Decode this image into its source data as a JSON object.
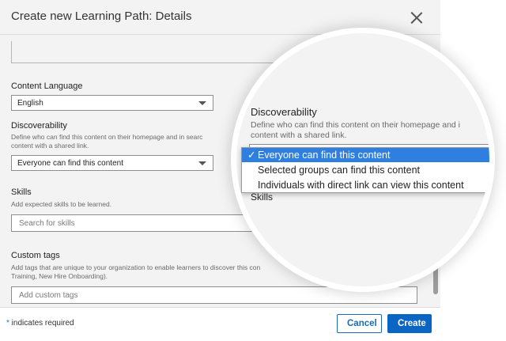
{
  "dialog": {
    "title": "Create new Learning Path: Details"
  },
  "form": {
    "content_language": {
      "label": "Content Language",
      "value": "English"
    },
    "discoverability": {
      "label": "Discoverability",
      "hint_line1": "Define who can find this content on their homepage and in searc",
      "hint_line2": "content with a shared link.",
      "value": "Everyone can find this content"
    },
    "skills": {
      "label": "Skills",
      "hint": "Add expected skills to be learned.",
      "placeholder": "Search for skills"
    },
    "custom_tags": {
      "label": "Custom tags",
      "hint_line1": "Add tags that are unique to your organization to enable learners to discover this con",
      "hint_line2": "Training, New Hire Onboarding).",
      "placeholder": "Add custom tags"
    }
  },
  "footer": {
    "required_asterisk": "*",
    "required_text": " indicates required",
    "cancel_label": "Cancel",
    "create_label": "Create"
  },
  "magnifier": {
    "label": "Discoverability",
    "hint_line1": "Define who can find this content on their homepage and i",
    "hint_line2": "content with a shared link.",
    "skills_label": "Skills",
    "check_mark": "✓",
    "options": [
      "Everyone can find this content",
      "Selected groups can find this content",
      "Individuals with direct link can view this content"
    ]
  },
  "colors": {
    "primary": "#0a66c2",
    "selected_option": "#2f7fe0",
    "panel_bg": "#f3f3f3"
  }
}
